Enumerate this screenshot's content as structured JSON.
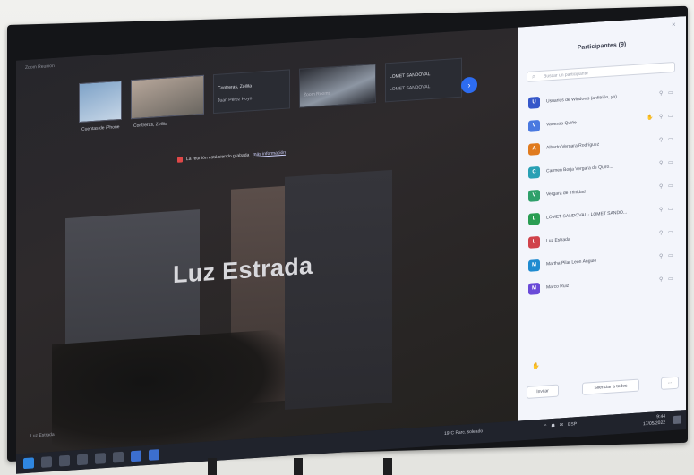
{
  "window_title": "Zoom Reunión",
  "thumbnails": [
    {
      "label": "Cuentas de iPhone"
    },
    {
      "label": "Contreras, Zoilita"
    }
  ],
  "text_tiles": [
    {
      "name": "Contreras, Zoilita",
      "sub": "Juan Pérez Hoyo"
    },
    {
      "name": "",
      "sub": "Zoom Rooms"
    },
    {
      "name": "LOMET SANDOVAL",
      "sub": "LOMET SANDOVAL"
    }
  ],
  "more_bubble": "›",
  "recording": {
    "text": "La reunión está siendo grabada",
    "link": "más información"
  },
  "speaker_name": "Luz Estrada",
  "corner_name": "Luz Estrada",
  "panel": {
    "title": "Participantes (9)",
    "close_icon": "×",
    "search_placeholder": "Buscar un participante",
    "participants": [
      {
        "name": "Usuarios de Windows (anfitrión, yo)",
        "color": "#3557c9",
        "initial": "U",
        "hand": false
      },
      {
        "name": "Vanessa Quiñe",
        "color": "#4a79e0",
        "initial": "V",
        "hand": true
      },
      {
        "name": "Alberto Vergara Rodríguez",
        "color": "#e07b1f",
        "initial": "A",
        "hand": false
      },
      {
        "name": "Carmen Borja Vergara de Quiro...",
        "color": "#28a0b4",
        "initial": "C",
        "hand": false
      },
      {
        "name": "Vergara de Trinidad",
        "color": "#2fa06a",
        "initial": "V",
        "hand": false
      },
      {
        "name": "LOMET SANDOVAL - LOMET SANDO...",
        "color": "#2a9d52",
        "initial": "L",
        "hand": false
      },
      {
        "name": "Luz Estrada",
        "color": "#d0424a",
        "initial": "L",
        "hand": false
      },
      {
        "name": "Martha Pilar Leon Angulo",
        "color": "#1f8bd0",
        "initial": "M",
        "hand": false
      },
      {
        "name": "Marco Ruiz",
        "color": "#6a4ad8",
        "initial": "M",
        "hand": false
      }
    ],
    "invite_label": "Invitar",
    "mute_label": "Silenciar a todos",
    "more_label": "···"
  },
  "taskbar": {
    "weather": "19°C  Parc. soleado",
    "tray": [
      "^",
      "☗",
      "✉",
      "ESP"
    ],
    "time": "9:44",
    "date": "17/05/2022"
  }
}
